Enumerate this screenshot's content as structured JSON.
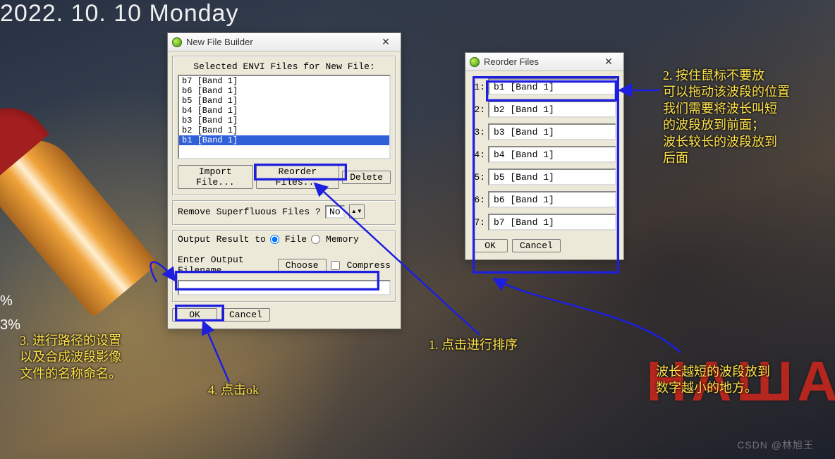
{
  "desktop": {
    "date_line": "2022. 10. 10  Monday",
    "bg_text": "НАША",
    "percent1": "%",
    "percent2": "3%",
    "watermark": "CSDN @林旭王"
  },
  "builder": {
    "title": "New File Builder",
    "section_label": "Selected ENVI Files for New File:",
    "files": [
      "b7 [Band 1]",
      "b6 [Band 1]",
      "b5 [Band 1]",
      "b4 [Band 1]",
      "b3 [Band 1]",
      "b2 [Band 1]",
      "b1 [Band 1]"
    ],
    "selected_index": 6,
    "import_label": "Import File...",
    "reorder_label": "Reorder Files...",
    "delete_label": "Delete",
    "remove_superfluous_label": "Remove Superfluous Files ?",
    "remove_superfluous_value": "No",
    "output_section_label": "Output Result to",
    "radio_file": "File",
    "radio_memory": "Memory",
    "enter_filename_label": "Enter Output Filename",
    "choose_label": "Choose",
    "compress_label": "Compress",
    "filename_value": "",
    "ok_label": "OK",
    "cancel_label": "Cancel"
  },
  "reorder": {
    "title": "Reorder Files",
    "rows": [
      {
        "n": "1:",
        "val": "b1 [Band 1]"
      },
      {
        "n": "2:",
        "val": "b2 [Band 1]"
      },
      {
        "n": "3:",
        "val": "b3 [Band 1]"
      },
      {
        "n": "4:",
        "val": "b4 [Band 1]"
      },
      {
        "n": "5:",
        "val": "b5 [Band 1]"
      },
      {
        "n": "6:",
        "val": "b6 [Band 1]"
      },
      {
        "n": "7:",
        "val": "b7 [Band 1]"
      }
    ],
    "ok_label": "OK",
    "cancel_label": "Cancel"
  },
  "annotations": {
    "a1": "1. 点击进行排序",
    "a2": "2. 按住鼠标不要放\n可以拖动该波段的位置\n我们需要将波长叫短\n的波段放到前面；\n波长较长的波段放到\n后面",
    "a3": "3. 进行路径的设置\n以及合成波段影像\n文件的名称命名。",
    "a4": "4. 点击ok",
    "a5": "波长越短的波段放到\n数字越小的地方。"
  }
}
